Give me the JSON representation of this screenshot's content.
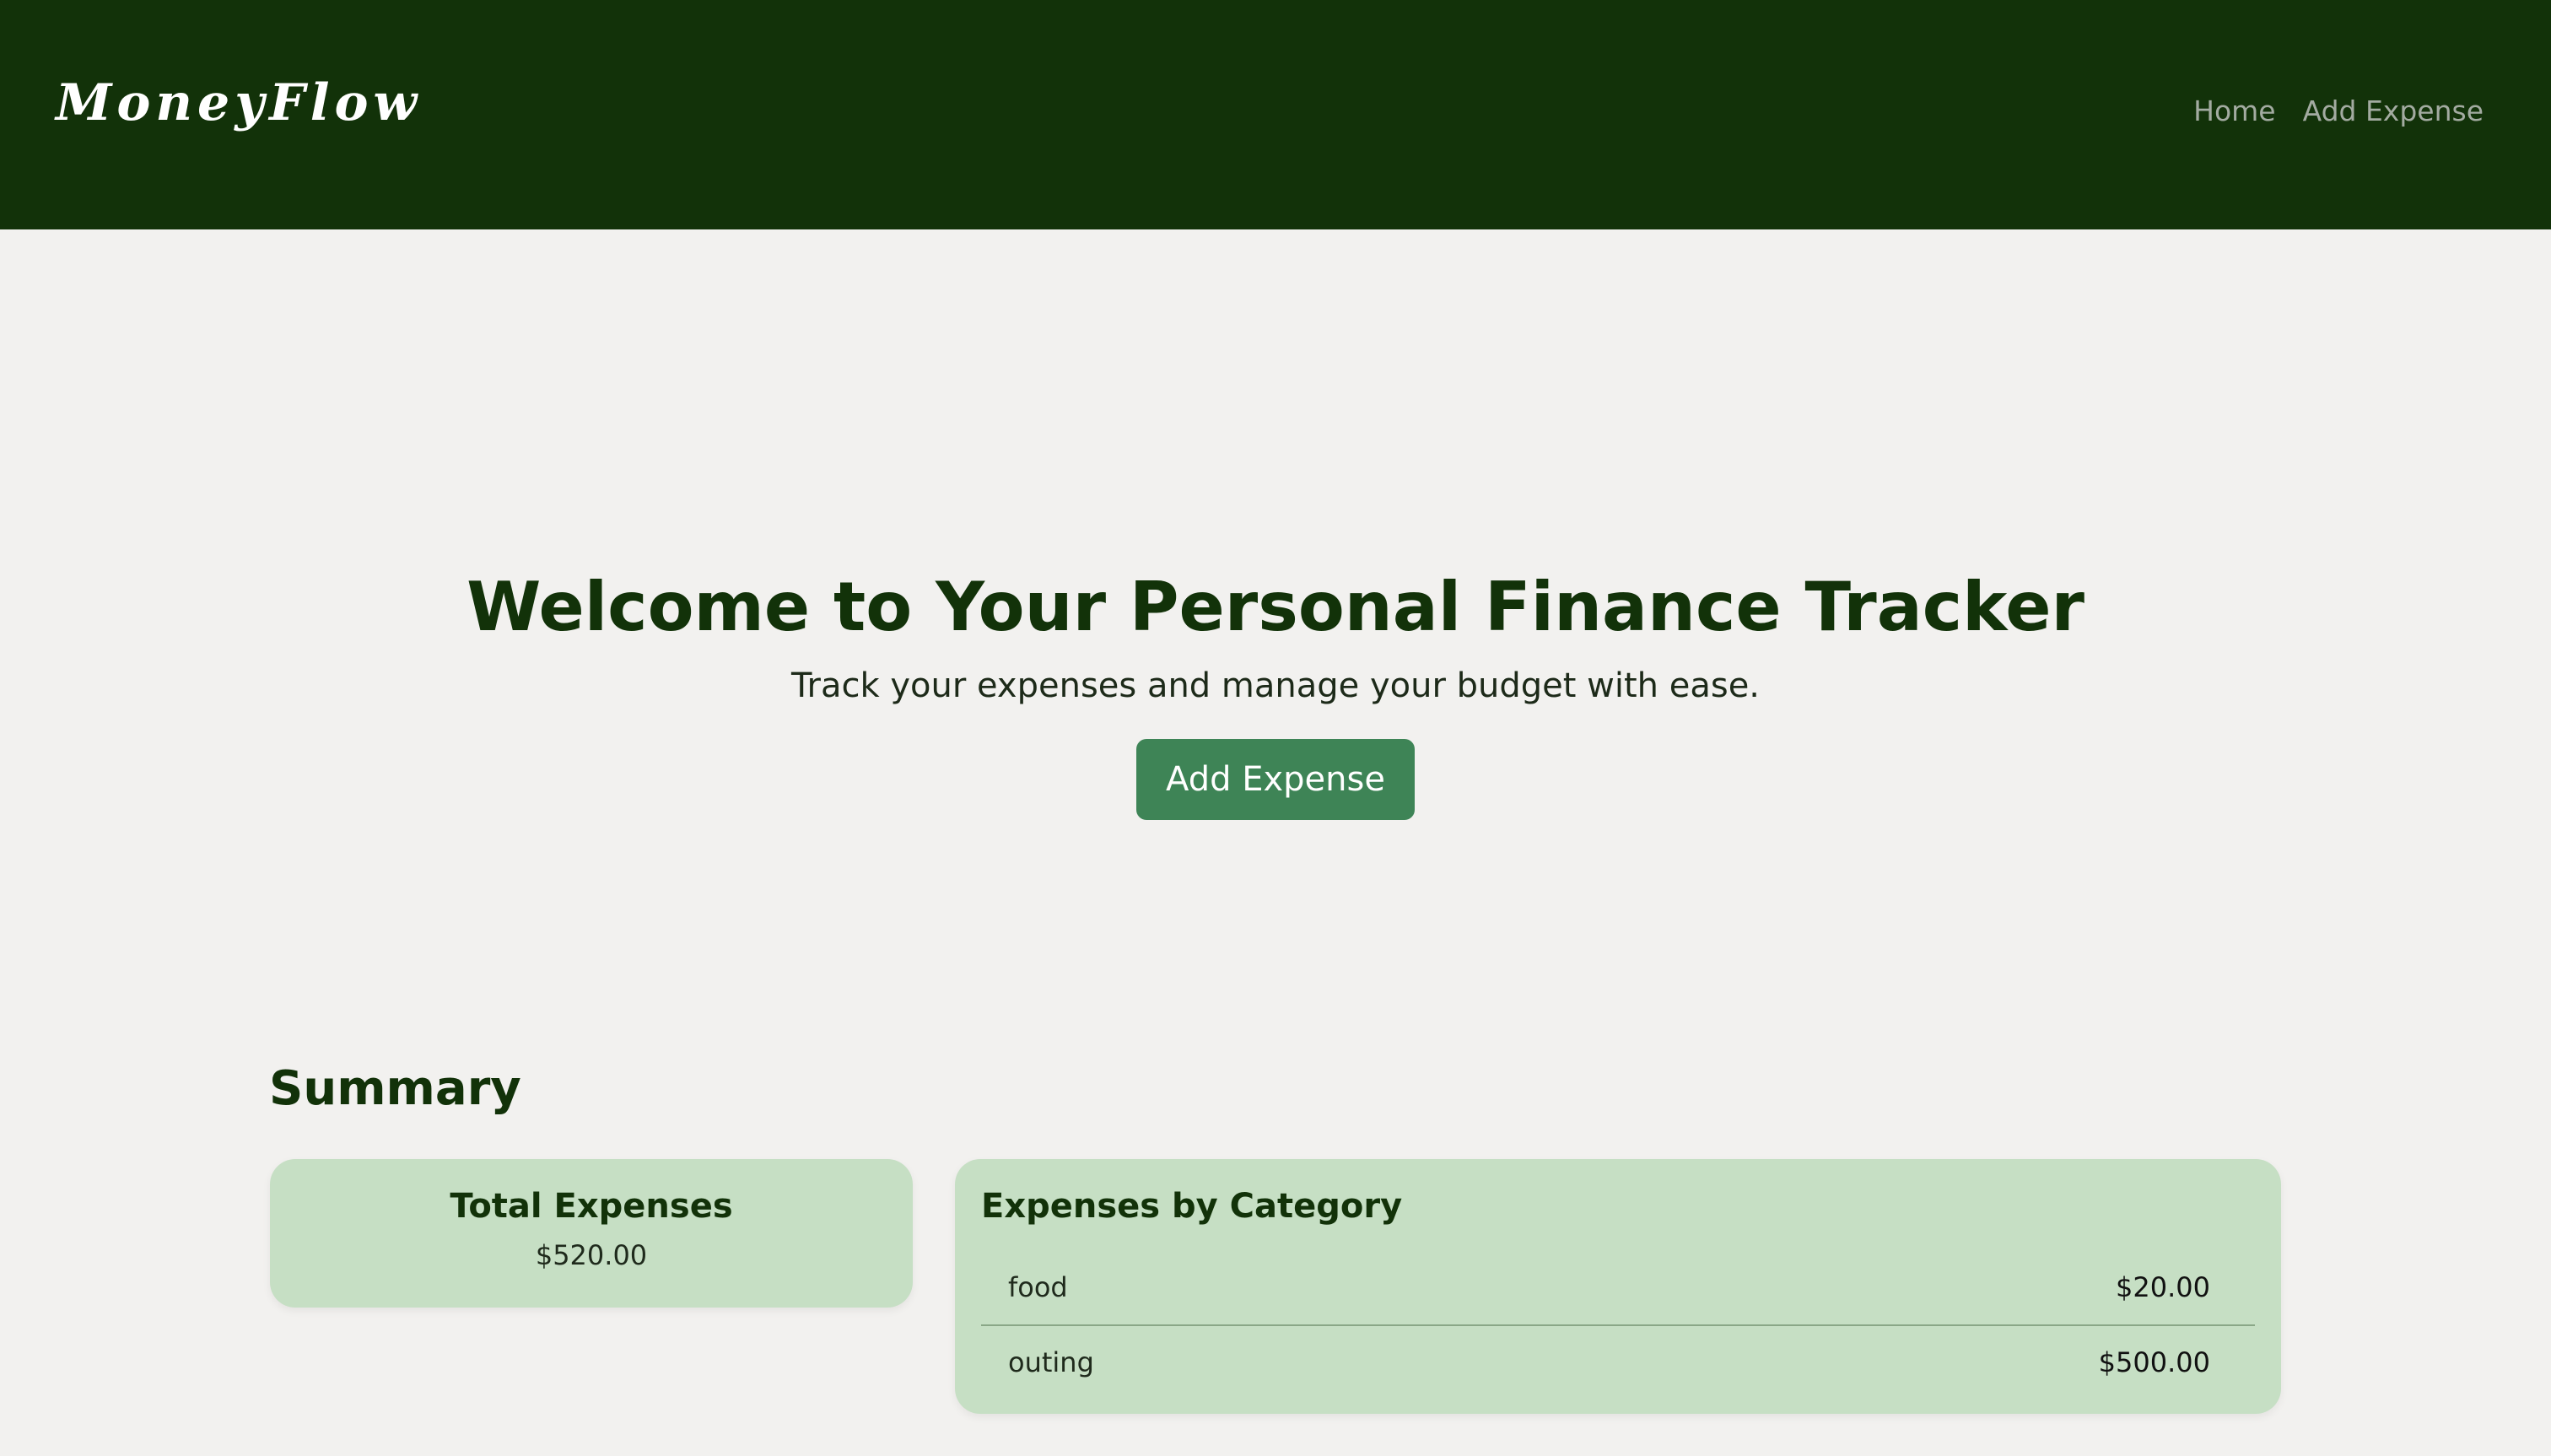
{
  "navbar": {
    "brand": "MoneyFlow",
    "links": [
      "Home",
      "Add Expense"
    ]
  },
  "hero": {
    "title": "Welcome to Your Personal Finance Tracker",
    "subtitle": "Track your expenses and manage your budget with ease.",
    "button_label": "Add Expense"
  },
  "summary": {
    "title": "Summary",
    "total": {
      "title": "Total Expenses",
      "amount": "$520.00"
    },
    "by_category": {
      "title": "Expenses by Category",
      "rows": [
        {
          "name": "food",
          "amount": "$20.00"
        },
        {
          "name": "outing",
          "amount": "$500.00"
        }
      ]
    }
  },
  "colors": {
    "navbar_bg": "#123209",
    "page_bg": "#f2f1ef",
    "accent_button": "#3e8456",
    "card_bg": "#c6dfc4",
    "heading_text": "#123209"
  }
}
